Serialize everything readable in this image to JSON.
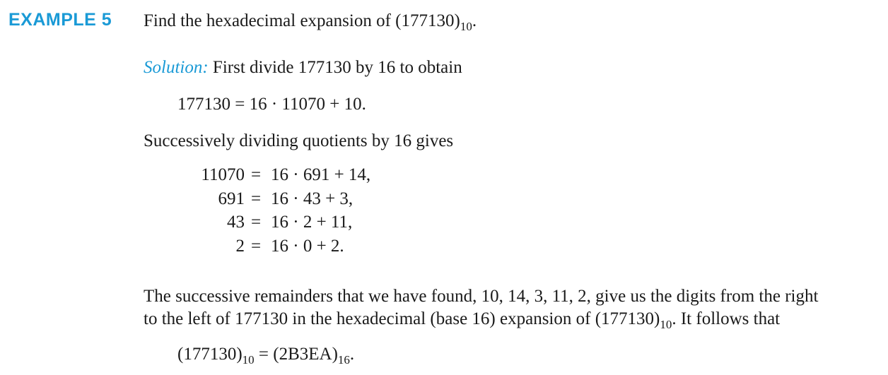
{
  "example": {
    "label": "EXAMPLE 5",
    "prompt": "Find the hexadecimal expansion of (177130)",
    "prompt_sub": "10",
    "prompt_end": "."
  },
  "solution": {
    "label": "Solution:",
    "intro": " First divide 177130 by 16 to obtain",
    "first_eq": "177130 = 16 · 11070 + 10.",
    "successive_intro": "Successively dividing quotients by 16 gives",
    "equations": [
      {
        "lhs": "11070",
        "rhs": "16 · 691 + 14,"
      },
      {
        "lhs": "691",
        "rhs": "16 · 43 + 3,"
      },
      {
        "lhs": "43",
        "rhs": "16 · 2 + 11,"
      },
      {
        "lhs": "2",
        "rhs": "16 · 0 + 2."
      }
    ],
    "equals": "=",
    "para_line1": "The successive remainders that we have found, 10, 14, 3, 11, 2, give us the digits from the right",
    "para_line2_a": "to the left of 177130 in the hexadecimal (base 16) expansion of (177130)",
    "para_line2_sub": "10",
    "para_line2_b": ". It follows that",
    "final": {
      "lhs": "(177130)",
      "lhs_sub": "10",
      "mid": " = (2B3EA)",
      "rhs_sub": "16",
      "end": "."
    }
  }
}
